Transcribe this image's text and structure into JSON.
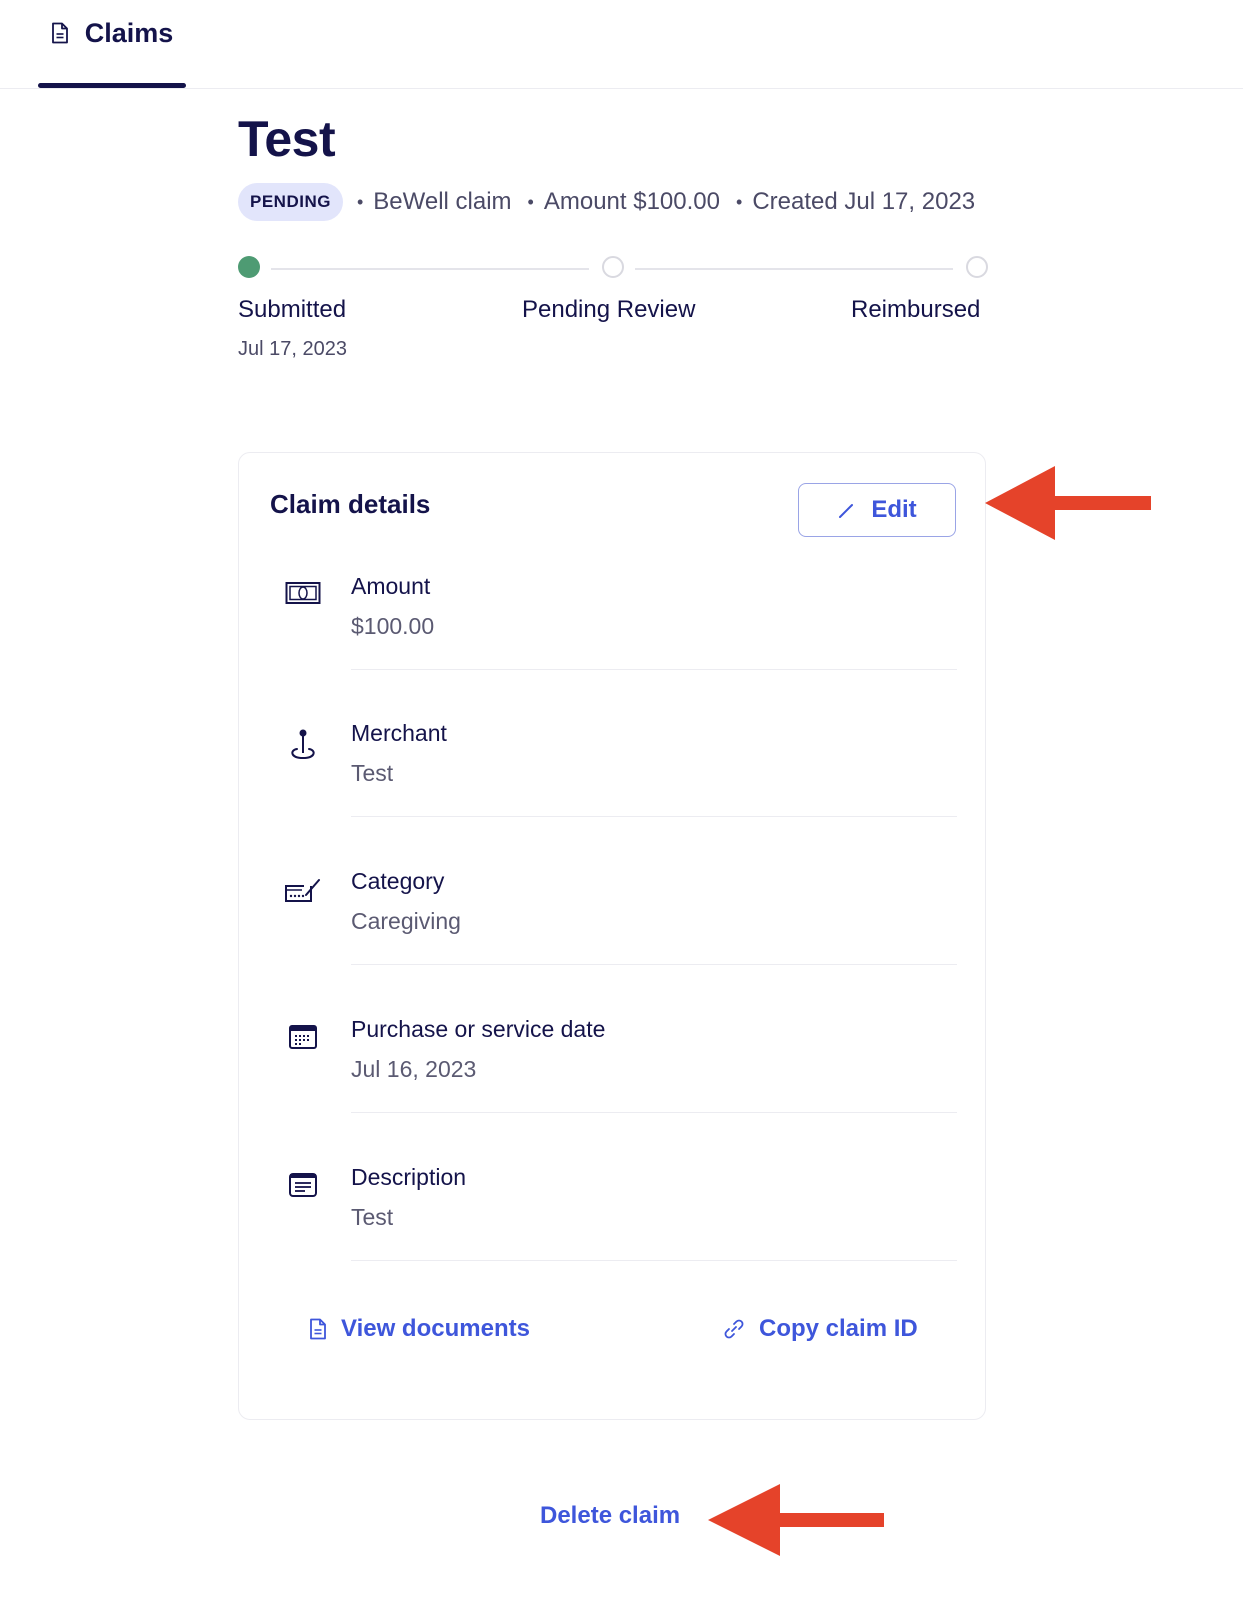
{
  "tabs": [
    {
      "label": "Claims",
      "icon": "document-icon",
      "active": true
    }
  ],
  "claim": {
    "title": "Test",
    "status_badge": "PENDING",
    "type": "BeWell claim",
    "amount_meta": "Amount $100.00",
    "created_meta": "Created Jul 17, 2023"
  },
  "progress": {
    "steps": [
      {
        "label": "Submitted",
        "date": "Jul 17, 2023",
        "state": "done"
      },
      {
        "label": "Pending Review",
        "date": "",
        "state": "todo"
      },
      {
        "label": "Reimbursed",
        "date": "",
        "state": "todo"
      }
    ]
  },
  "details": {
    "title": "Claim details",
    "edit_label": "Edit",
    "rows": [
      {
        "label": "Amount",
        "value": "$100.00",
        "icon": "money-icon"
      },
      {
        "label": "Merchant",
        "value": "Test",
        "icon": "location-pin-icon"
      },
      {
        "label": "Category",
        "value": "Caregiving",
        "icon": "card-pen-icon"
      },
      {
        "label": "Purchase or service date",
        "value": "Jul 16, 2023",
        "icon": "calendar-icon"
      },
      {
        "label": "Description",
        "value": "Test",
        "icon": "note-icon"
      }
    ],
    "view_documents_label": "View documents",
    "copy_claim_id_label": "Copy claim ID"
  },
  "delete_label": "Delete claim",
  "colors": {
    "primary_text": "#14134a",
    "link": "#3e56db",
    "badge_bg": "#e2e5fb",
    "step_done": "#4e9b73",
    "annotation_arrow": "#e5432a"
  }
}
